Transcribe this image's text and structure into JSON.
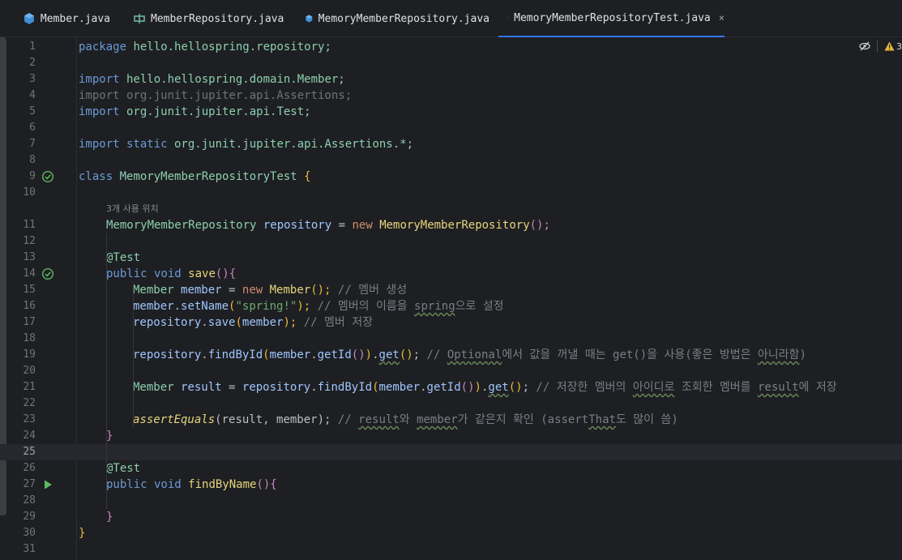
{
  "tabs": [
    {
      "label": "Member.java",
      "icon": "java-class-icon",
      "active": false
    },
    {
      "label": "MemberRepository.java",
      "icon": "java-interface-icon",
      "active": false
    },
    {
      "label": "MemoryMemberRepository.java",
      "icon": "java-class-icon",
      "active": false
    },
    {
      "label": "MemoryMemberRepositoryTest.java",
      "icon": "java-class-icon",
      "active": true,
      "close": "×"
    }
  ],
  "editor": {
    "warnings_count": "3",
    "current_line": 25,
    "usage_hint": "3개 사용 위치",
    "line_numbers": [
      "1",
      "2",
      "3",
      "4",
      "5",
      "6",
      "7",
      "8",
      "9",
      "10",
      "11",
      "12",
      "13",
      "14",
      "15",
      "16",
      "17",
      "18",
      "19",
      "20",
      "21",
      "22",
      "23",
      "24",
      "25",
      "26",
      "27",
      "28",
      "29",
      "30",
      "31"
    ],
    "code": {
      "l1_kw": "package",
      "l1_rest": " hello.hellospring.repository;",
      "l3_kw": "import",
      "l3_rest": " hello.hellospring.domain.Member;",
      "l4": "import org.junit.jupiter.api.Assertions;",
      "l5_kw": "import",
      "l5_rest": " org.junit.jupiter.api.Test;",
      "l7_kw": "import static",
      "l7_rest": " org.junit.jupiter.api.Assertions.*;",
      "l9_kw": "class",
      "l9_cls": " MemoryMemberRepositoryTest ",
      "l9_br": "{",
      "l11_type": "MemoryMemberRepository ",
      "l11_field": "repository",
      "l11_eq": " = ",
      "l11_new": "new ",
      "l11_ctor": "MemoryMemberRepository",
      "l11_end": "();",
      "l13": "@Test",
      "l14_kw": "public void ",
      "l14_fn": "save",
      "l14_end": "(){",
      "l15_type": "Member ",
      "l15_var": "member",
      "l15_eq": " = ",
      "l15_new": "new ",
      "l15_ctor": "Member",
      "l15_end": "();",
      "l15_cmt": " // 멤버 생성",
      "l16_var": "member",
      "l16_dot": ".",
      "l16_fn": "setName",
      "l16_p1": "(",
      "l16_str": "\"spring!\"",
      "l16_p2": ");",
      "l16_cmt1": " // 멤버의 이름을 ",
      "l16_cmt_sq": "spring",
      "l16_cmt2": "으로 설정",
      "l17_var": "repository",
      "l17_dot": ".",
      "l17_fn": "save",
      "l17_p1": "(",
      "l17_arg": "member",
      "l17_p2": ");",
      "l17_cmt": " // 멤버 저장",
      "l19_var": "repository",
      "l19_fn": "findById",
      "l19_arg": "member",
      "l19_get": "getId",
      "l19_get2": "get",
      "l19_cmt1": " // ",
      "l19_cmt_sq1": "Optional",
      "l19_cmt2": "에서 값을 꺼낼 때는 get()을 사용(좋은 방법은 ",
      "l19_cmt_sq2": "아니라함",
      "l19_cmt3": ")",
      "l21_type": "Member ",
      "l21_var": "result",
      "l21_eq": " = ",
      "l21_repo": "repository",
      "l21_fn": "findById",
      "l21_arg": "member",
      "l21_get": "getId",
      "l21_get2": "get",
      "l21_cmt1": " // 저장한 멤버의 ",
      "l21_cmt_sq1": "아이디로",
      "l21_cmt2": " 조회한 멤버를 ",
      "l21_cmt_sq2": "result",
      "l21_cmt3": "에 저장",
      "l23_fn": "assertEquals",
      "l23_args": "(result, member);",
      "l23_cmt1": " // ",
      "l23_cmt_sq1": "result",
      "l23_cmt2": "와 ",
      "l23_cmt_sq2": "member",
      "l23_cmt3": "가 같은지 확인 (assert",
      "l23_cmt_sq3": "That",
      "l23_cmt4": "도 많이 씀)",
      "l24": "}",
      "l26": "@Test",
      "l27_kw": "public void ",
      "l27_fn": "findByName",
      "l27_end": "(){",
      "l29": "}",
      "l30": "}"
    }
  }
}
